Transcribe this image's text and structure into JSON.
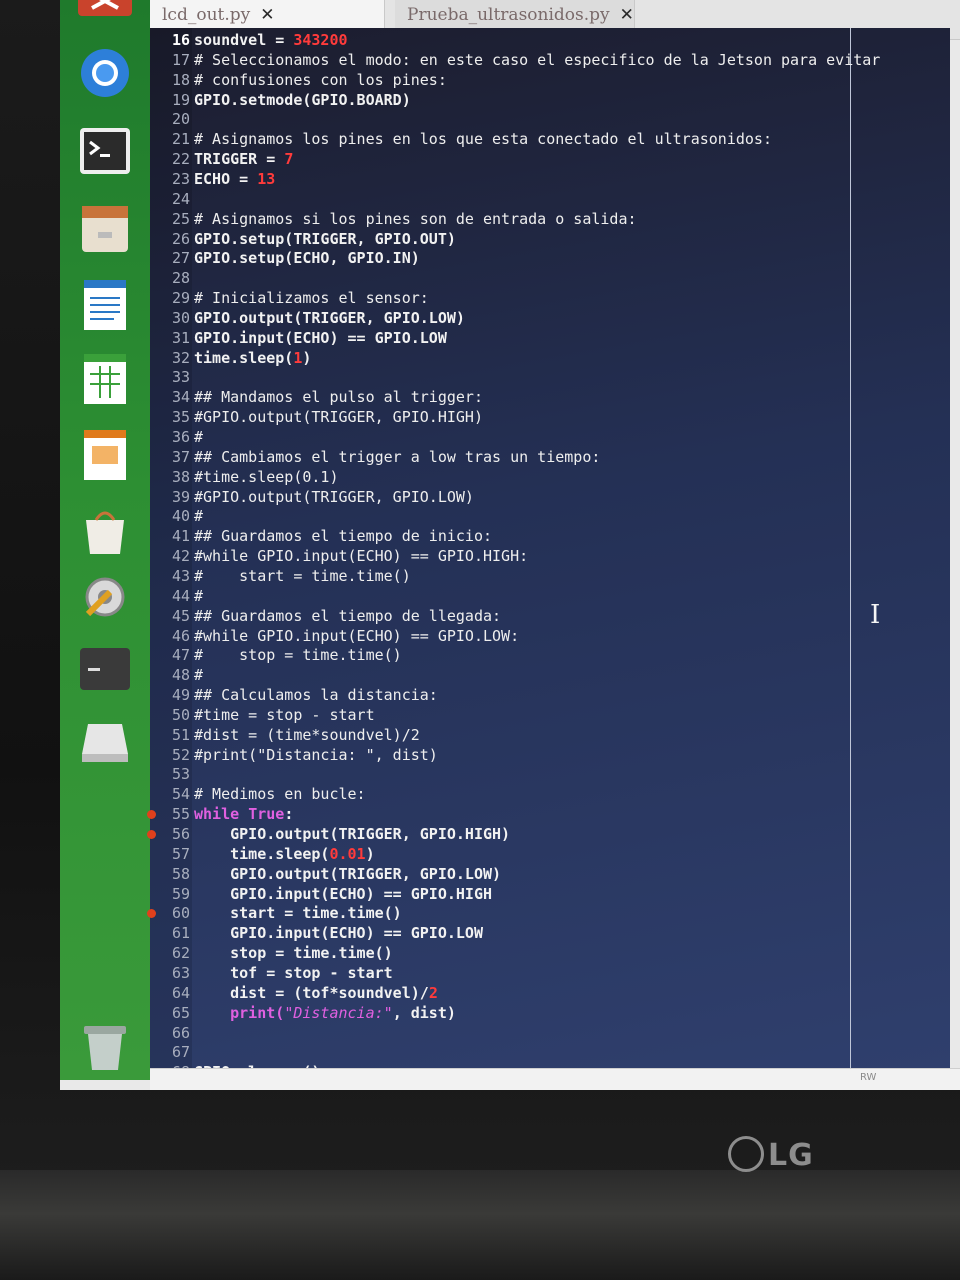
{
  "monitor": {
    "brand": "LG"
  },
  "tabs": [
    {
      "label": "lcd_out.py",
      "close": "✕"
    },
    {
      "label": "Prueba_ultrasonidos.py",
      "close": "✕"
    }
  ],
  "launcher": {
    "items": [
      {
        "icon": "ubuntu-dash-icon"
      },
      {
        "icon": "chromium-icon"
      },
      {
        "icon": "terminal-icon"
      },
      {
        "icon": "files-icon"
      },
      {
        "icon": "libreoffice-writer-icon"
      },
      {
        "icon": "libreoffice-calc-icon"
      },
      {
        "icon": "libreoffice-impress-icon"
      },
      {
        "icon": "software-center-icon"
      },
      {
        "icon": "system-settings-icon"
      },
      {
        "icon": "terminal-active-icon"
      },
      {
        "icon": "removable-drive-icon"
      },
      {
        "icon": "trash-icon"
      }
    ]
  },
  "editor": {
    "current_line": "16",
    "lines": [
      {
        "n": "16",
        "parts": [
          [
            "txt",
            "soundvel = "
          ],
          [
            "num",
            "343200"
          ]
        ]
      },
      {
        "n": "17",
        "parts": [
          [
            "com",
            "# Seleccionamos el modo: en este caso el especifico de la Jetson para evitar"
          ]
        ]
      },
      {
        "n": "18",
        "parts": [
          [
            "com",
            "# confusiones con los pines:"
          ]
        ]
      },
      {
        "n": "19",
        "parts": [
          [
            "txt",
            "GPIO.setmode(GPIO.BOARD)"
          ]
        ]
      },
      {
        "n": "20",
        "parts": []
      },
      {
        "n": "21",
        "parts": [
          [
            "com",
            "# Asignamos los pines en los que esta conectado el ultrasonidos:"
          ]
        ]
      },
      {
        "n": "22",
        "parts": [
          [
            "txt",
            "TRIGGER = "
          ],
          [
            "num",
            "7"
          ]
        ]
      },
      {
        "n": "23",
        "parts": [
          [
            "txt",
            "ECHO = "
          ],
          [
            "num",
            "13"
          ]
        ]
      },
      {
        "n": "24",
        "parts": []
      },
      {
        "n": "25",
        "parts": [
          [
            "com",
            "# Asignamos si los pines son de entrada o salida:"
          ]
        ]
      },
      {
        "n": "26",
        "parts": [
          [
            "txt",
            "GPIO.setup(TRIGGER, GPIO.OUT)"
          ]
        ]
      },
      {
        "n": "27",
        "parts": [
          [
            "txt",
            "GPIO.setup(ECHO, GPIO.IN)"
          ]
        ]
      },
      {
        "n": "28",
        "parts": []
      },
      {
        "n": "29",
        "parts": [
          [
            "com",
            "# Inicializamos el sensor:"
          ]
        ]
      },
      {
        "n": "30",
        "parts": [
          [
            "txt",
            "GPIO.output(TRIGGER, GPIO.LOW)"
          ]
        ]
      },
      {
        "n": "31",
        "parts": [
          [
            "txt",
            "GPIO.input(ECHO) == GPIO.LOW"
          ]
        ]
      },
      {
        "n": "32",
        "parts": [
          [
            "txt",
            "time.sleep("
          ],
          [
            "num",
            "1"
          ],
          [
            "txt",
            ")"
          ]
        ]
      },
      {
        "n": "33",
        "parts": []
      },
      {
        "n": "34",
        "parts": [
          [
            "com",
            "## Mandamos el pulso al trigger:"
          ]
        ]
      },
      {
        "n": "35",
        "parts": [
          [
            "com",
            "#GPIO.output(TRIGGER, GPIO.HIGH)"
          ]
        ]
      },
      {
        "n": "36",
        "parts": [
          [
            "com",
            "#"
          ]
        ]
      },
      {
        "n": "37",
        "parts": [
          [
            "com",
            "## Cambiamos el trigger a low tras un tiempo:"
          ]
        ]
      },
      {
        "n": "38",
        "parts": [
          [
            "com",
            "#time.sleep(0.1)"
          ]
        ]
      },
      {
        "n": "39",
        "parts": [
          [
            "com",
            "#GPIO.output(TRIGGER, GPIO.LOW)"
          ]
        ]
      },
      {
        "n": "40",
        "parts": [
          [
            "com",
            "#"
          ]
        ]
      },
      {
        "n": "41",
        "parts": [
          [
            "com",
            "## Guardamos el tiempo de inicio:"
          ]
        ]
      },
      {
        "n": "42",
        "parts": [
          [
            "com",
            "#while GPIO.input(ECHO) == GPIO.HIGH:"
          ]
        ]
      },
      {
        "n": "43",
        "parts": [
          [
            "com",
            "#    start = time.time()"
          ]
        ]
      },
      {
        "n": "44",
        "parts": [
          [
            "com",
            "#"
          ]
        ]
      },
      {
        "n": "45",
        "parts": [
          [
            "com",
            "## Guardamos el tiempo de llegada:"
          ]
        ]
      },
      {
        "n": "46",
        "parts": [
          [
            "com",
            "#while GPIO.input(ECHO) == GPIO.LOW:"
          ]
        ]
      },
      {
        "n": "47",
        "parts": [
          [
            "com",
            "#    stop = time.time()"
          ]
        ]
      },
      {
        "n": "48",
        "parts": [
          [
            "com",
            "#"
          ]
        ]
      },
      {
        "n": "49",
        "parts": [
          [
            "com",
            "## Calculamos la distancia:"
          ]
        ]
      },
      {
        "n": "50",
        "parts": [
          [
            "com",
            "#time = stop - start"
          ]
        ]
      },
      {
        "n": "51",
        "parts": [
          [
            "com",
            "#dist = (time*soundvel)/2"
          ]
        ]
      },
      {
        "n": "52",
        "parts": [
          [
            "com",
            "#print(\"Distancia: \", dist)"
          ]
        ]
      },
      {
        "n": "53",
        "parts": []
      },
      {
        "n": "54",
        "parts": [
          [
            "com",
            "# Medimos en bucle:"
          ]
        ]
      },
      {
        "n": "55",
        "parts": [
          [
            "kw",
            "while "
          ],
          [
            "kw",
            "True"
          ],
          [
            "txt",
            ":"
          ]
        ],
        "bp": true
      },
      {
        "n": "56",
        "parts": [
          [
            "txt",
            "    GPIO.output(TRIGGER, GPIO.HIGH)"
          ]
        ],
        "bp": true
      },
      {
        "n": "57",
        "parts": [
          [
            "txt",
            "    time.sleep("
          ],
          [
            "num",
            "0.01"
          ],
          [
            "txt",
            ")"
          ]
        ]
      },
      {
        "n": "58",
        "parts": [
          [
            "txt",
            "    GPIO.output(TRIGGER, GPIO.LOW)"
          ]
        ]
      },
      {
        "n": "59",
        "parts": [
          [
            "txt",
            "    GPIO.input(ECHO) == GPIO.HIGH"
          ]
        ]
      },
      {
        "n": "60",
        "parts": [
          [
            "txt",
            "    start = time.time()"
          ]
        ],
        "bp": true
      },
      {
        "n": "61",
        "parts": [
          [
            "txt",
            "    GPIO.input(ECHO) == GPIO.LOW"
          ]
        ]
      },
      {
        "n": "62",
        "parts": [
          [
            "txt",
            "    stop = time.time()"
          ]
        ]
      },
      {
        "n": "63",
        "parts": [
          [
            "txt",
            "    tof = stop - start"
          ]
        ]
      },
      {
        "n": "64",
        "parts": [
          [
            "txt",
            "    dist = (tof*soundvel)/"
          ],
          [
            "num",
            "2"
          ]
        ]
      },
      {
        "n": "65",
        "parts": [
          [
            "kw",
            "    print("
          ],
          [
            "str",
            "\"Distancia:\""
          ],
          [
            "txt",
            ", dist)"
          ]
        ]
      },
      {
        "n": "66",
        "parts": []
      },
      {
        "n": "67",
        "parts": []
      },
      {
        "n": "68",
        "parts": [
          [
            "txt",
            "GPIO.cleanup()"
          ]
        ]
      }
    ]
  },
  "statusbar": {
    "mode": "RW"
  },
  "colors": {
    "editor_bg": "#243055",
    "launcher": "#2d8f33",
    "number": "#ff3b3b",
    "keyword": "#e060e0"
  }
}
